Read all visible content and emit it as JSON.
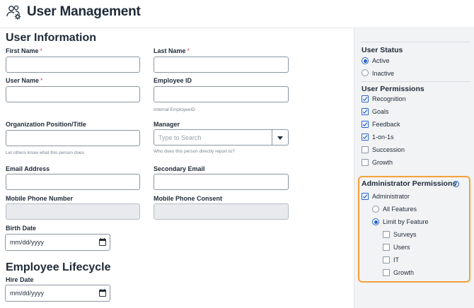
{
  "header": {
    "title": "User Management",
    "icon": "users-gear-icon"
  },
  "user_information": {
    "title": "User Information",
    "first_name": {
      "label": "First Name",
      "required": "*",
      "value": ""
    },
    "last_name": {
      "label": "Last Name",
      "required": "*",
      "value": ""
    },
    "user_name": {
      "label": "User Name",
      "required": "*",
      "value": ""
    },
    "employee_id": {
      "label": "Employee ID",
      "value": "",
      "help": "Internal EmployeeID"
    },
    "position": {
      "label": "Organization Position/Title",
      "value": "",
      "help": "Let others know what this person does."
    },
    "manager": {
      "label": "Manager",
      "placeholder": "Type to Search",
      "help": "Who does this person directly report to?"
    },
    "email": {
      "label": "Email Address",
      "value": ""
    },
    "secondary_email": {
      "label": "Secondary Email",
      "value": ""
    },
    "mobile_phone": {
      "label": "Mobile Phone Number",
      "value": ""
    },
    "mobile_consent": {
      "label": "Mobile Phone Consent",
      "value": ""
    },
    "birth_date": {
      "label": "Birth Date",
      "placeholder": "mm/dd/yyyy"
    }
  },
  "employee_lifecycle": {
    "title": "Employee Lifecycle",
    "hire_date": {
      "label": "Hire Date",
      "placeholder": "mm/dd/yyyy"
    }
  },
  "sidebar": {
    "user_status": {
      "title": "User Status",
      "options": [
        {
          "label": "Active",
          "selected": true
        },
        {
          "label": "Inactive",
          "selected": false
        }
      ]
    },
    "user_permissions": {
      "title": "User Permissions",
      "items": [
        {
          "label": "Recognition",
          "checked": true
        },
        {
          "label": "Goals",
          "checked": true
        },
        {
          "label": "Feedback",
          "checked": true
        },
        {
          "label": "1-on-1s",
          "checked": true
        },
        {
          "label": "Succession",
          "checked": false
        },
        {
          "label": "Growth",
          "checked": false
        }
      ]
    },
    "admin_permissions": {
      "title": "Administrator Permissions",
      "help_glyph": "?",
      "administrator": {
        "label": "Administrator",
        "checked": true
      },
      "scope": [
        {
          "label": "All Features",
          "selected": false
        },
        {
          "label": "Limit by Feature",
          "selected": true
        }
      ],
      "features": [
        {
          "label": "Surveys",
          "checked": false
        },
        {
          "label": "Users",
          "checked": false
        },
        {
          "label": "IT",
          "checked": false
        },
        {
          "label": "Growth",
          "checked": false
        }
      ]
    }
  },
  "colors": {
    "accent": "#2563c9",
    "highlight_border": "#f4a23a",
    "required": "#d64545",
    "sidebar_bg": "#f2f3f5"
  }
}
